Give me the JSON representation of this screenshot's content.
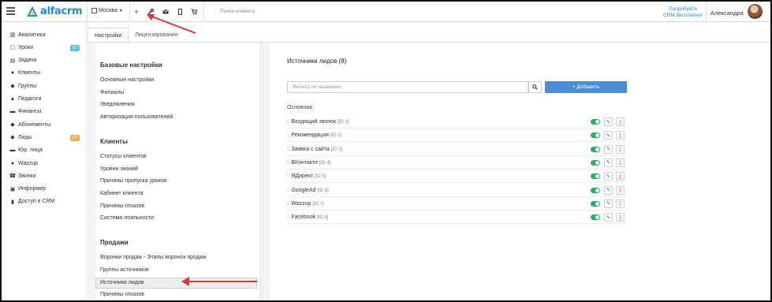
{
  "topbar": {
    "logo_text": "alfacrm",
    "branch": "Москва",
    "search_placeholder": "Поиск клиента",
    "promo_line1": "Попробуйте",
    "promo_line2": "CRM бесплатно!",
    "username": "Александра",
    "icons": [
      "menu-icon",
      "plus-icon",
      "wrench-icon",
      "mail-icon",
      "mobile-icon",
      "cart-icon"
    ]
  },
  "sidebar": {
    "items": [
      {
        "label": "Аналитика",
        "icon": "chart-icon"
      },
      {
        "label": "Уроки",
        "icon": "calendar-icon",
        "badge": "57",
        "badge_color": "#5bc0de"
      },
      {
        "label": "Задачи",
        "icon": "tasks-icon"
      },
      {
        "label": "Клиенты",
        "icon": "user-icon"
      },
      {
        "label": "Группы",
        "icon": "group-icon"
      },
      {
        "label": "Педагоги",
        "icon": "graduation-cap-icon"
      },
      {
        "label": "Финансы",
        "icon": "money-icon"
      },
      {
        "label": "Абонементы",
        "icon": "tag-icon"
      },
      {
        "label": "Лиды",
        "icon": "leads-icon",
        "badge": "22",
        "badge_color": "#f0ad4e"
      },
      {
        "label": "Юр. лица",
        "icon": "briefcase-icon"
      },
      {
        "label": "Wazzup",
        "icon": "whatsapp-icon"
      },
      {
        "label": "Звонки",
        "icon": "phone-icon"
      },
      {
        "label": "Информер",
        "icon": "informer-icon"
      },
      {
        "label": "Доступ в CRM",
        "icon": "lock-icon"
      }
    ]
  },
  "tabs": [
    {
      "label": "Настройки",
      "active": true
    },
    {
      "label": "Лицензирование",
      "active": false
    }
  ],
  "settings": {
    "sections": [
      {
        "title": "Базовые настройки",
        "links": [
          "Основные настройки",
          "Филиалы",
          "Уведомления",
          "Авторизация пользователей"
        ]
      },
      {
        "title": "Клиенты",
        "links": [
          "Статусы клиентов",
          "Уровни знаний",
          "Причины пропуска уроков",
          "Кабинет клиента",
          "Причины отказов",
          "Система лояльности"
        ]
      },
      {
        "title": "Продажи",
        "links": [
          "Воронки продаж - Этапы воронок продаж",
          "Группы источников",
          "Источники лидов",
          "Причины отказов"
        ]
      }
    ],
    "selected": "Источники лидов"
  },
  "panel": {
    "title": "Источники лидов",
    "count": "(8)",
    "filter_placeholder": "Фильтр по названию",
    "add_label": "+ Добавить",
    "group_label": "Основная",
    "rows": [
      {
        "name": "Входящий звонок",
        "id": "[ID 1]"
      },
      {
        "name": "Рекомендация",
        "id": "[ID 2]"
      },
      {
        "name": "Заявка с сайта",
        "id": "[ID 3]"
      },
      {
        "name": "ВКонтакте",
        "id": "[ID 4]"
      },
      {
        "name": "ЯДирект",
        "id": "[ID 5]"
      },
      {
        "name": "GoogleAd",
        "id": "[ID 6]"
      },
      {
        "name": "Wazzup",
        "id": "[ID 7]"
      },
      {
        "name": "Facebook",
        "id": "[ID 8]"
      }
    ]
  },
  "colors": {
    "accent": "#2b89c8",
    "button": "#4a8fd4",
    "toggle_on": "#27ae60",
    "delete": "#e74c3c",
    "annotation_arrow": "#d9363e"
  }
}
